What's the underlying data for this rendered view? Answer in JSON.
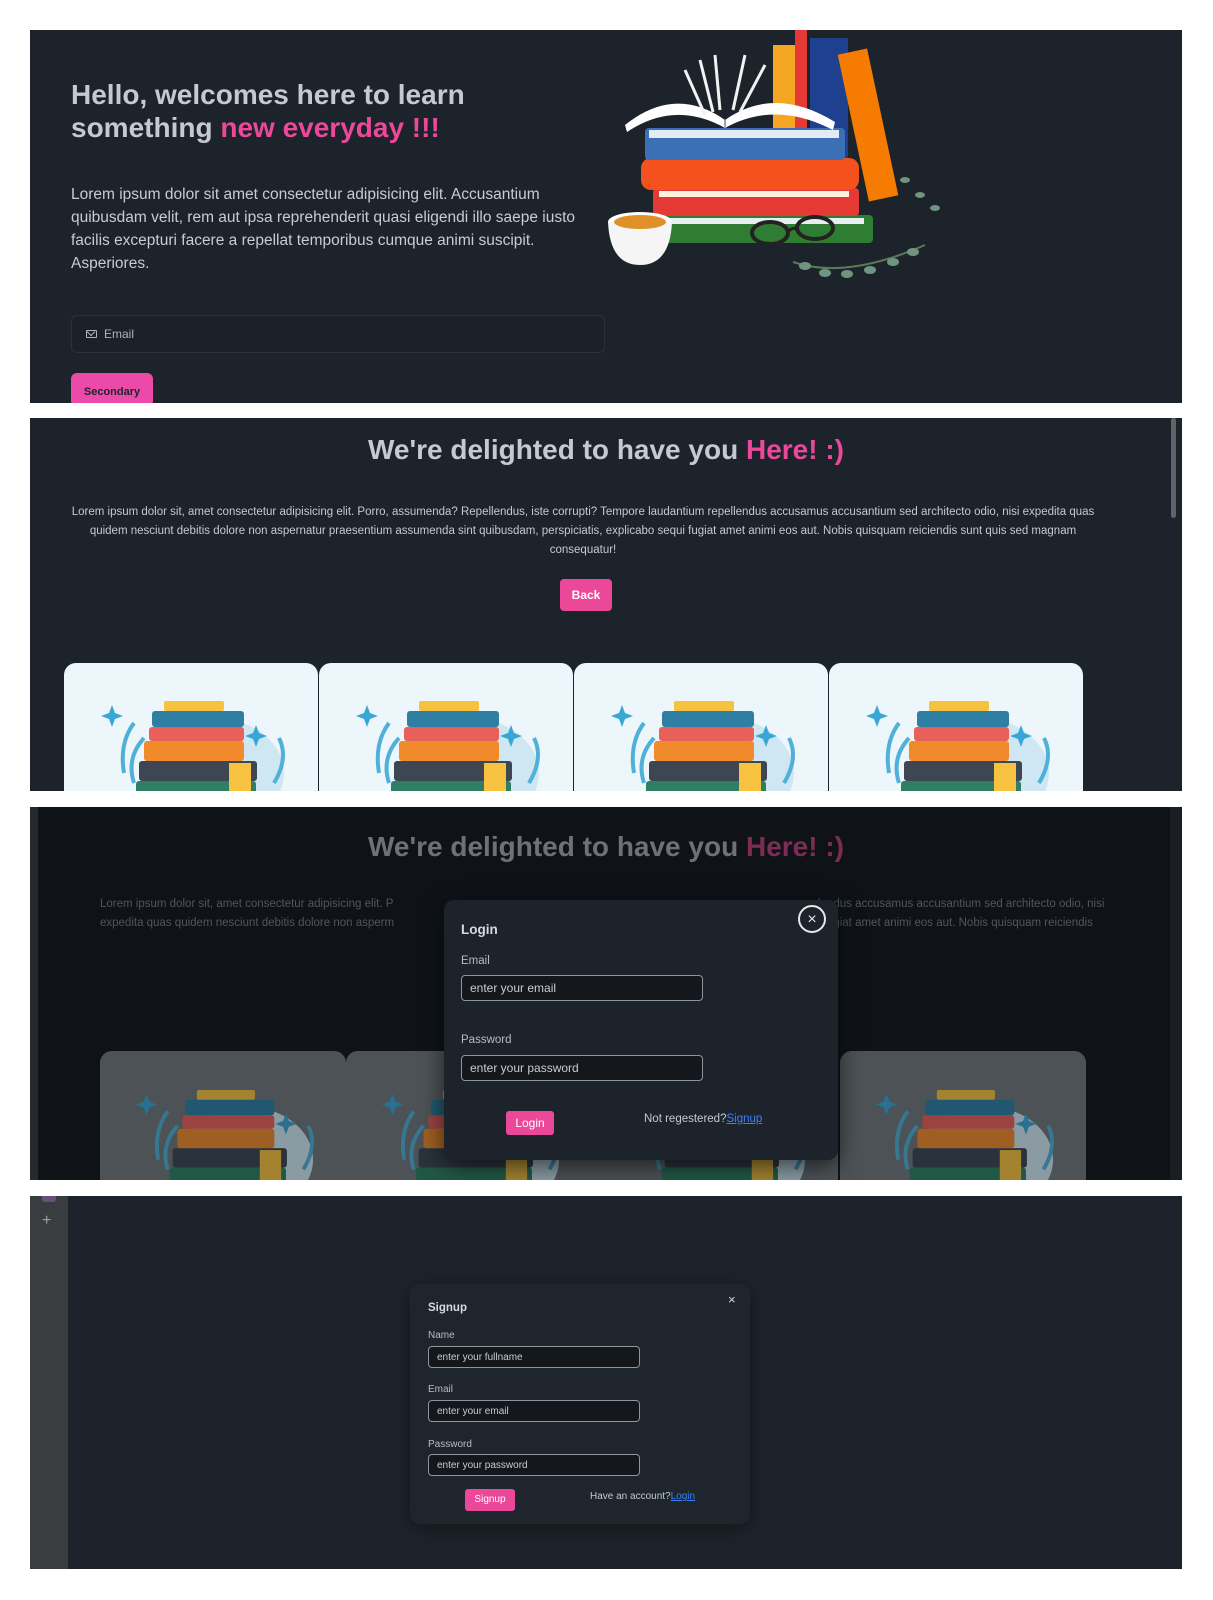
{
  "hero": {
    "title_line1": "Hello, welcomes here to learn",
    "title_line2_plain": "something ",
    "title_line2_accent": "new everyday !!!",
    "text": "Lorem ipsum dolor sit amet consectetur adipisicing elit. Accusantium quibusdam velit, rem aut ipsa reprehenderit quasi eligendi illo saepe iusto facilis excepturi facere a repellat temporibus cumque animi suscipit. Asperiores.",
    "email_placeholder": "Email",
    "email_icon": "mail-icon",
    "secondary_button": "Secondary"
  },
  "about": {
    "title_plain": "We're delighted to have you ",
    "title_accent": "Here! :)",
    "text": "Lorem ipsum dolor sit, amet consectetur adipisicing elit. Porro, assumenda? Repellendus, iste corrupti? Tempore laudantium repellendus accusamus accusantium sed architecto odio, nisi expedita quas quidem nesciunt debitis dolore non aspernatur praesentium assumenda sint quibusdam, perspiciatis, explicabo sequi fugiat amet animi eos aut. Nobis quisquam reiciendis sunt quis sed magnam consequatur!",
    "back_button": "Back",
    "card_count": 4
  },
  "login_view": {
    "title_plain": "We're delighted to have you ",
    "title_accent": "Here! :)",
    "bg_text_left_1": "Lorem ipsum dolor sit, amet consectetur adipisicing elit. P",
    "bg_text_left_2": "expedita quas quidem nesciunt debitis dolore non asperm",
    "bg_text_right_1": "lendus accusamus accusantium sed architecto odio, nisi",
    "bg_text_right_2": "i fugiat amet animi eos aut. Nobis quisquam reiciendis",
    "modal": {
      "title": "Login",
      "close_symbol": "×",
      "email_label": "Email",
      "email_placeholder": "enter your email",
      "password_label": "Password",
      "password_placeholder": "enter your password",
      "login_button": "Login",
      "register_text": "Not regestered?",
      "register_link": "Signup"
    }
  },
  "signup_view": {
    "plus_symbol": "+",
    "modal": {
      "title": "Signup",
      "close_symbol": "×",
      "name_label": "Name",
      "name_placeholder": "enter your fullname",
      "email_label": "Email",
      "email_placeholder": "enter your email",
      "password_label": "Password",
      "password_placeholder": "enter your password",
      "signup_button": "Signup",
      "account_text": "Have an account?",
      "account_link": "Login"
    }
  },
  "colors": {
    "accent": "#ec4899",
    "background": "#1d232a",
    "link": "#3b82f6"
  }
}
